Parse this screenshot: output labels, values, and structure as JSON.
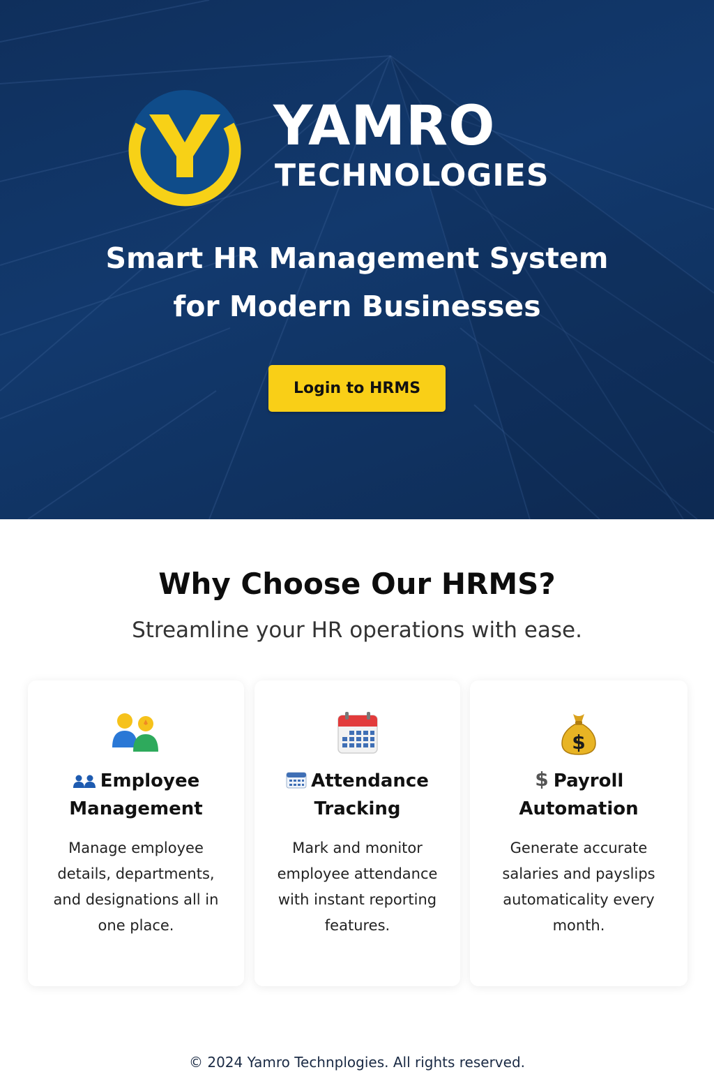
{
  "brand": {
    "name": "YAMRO",
    "subtitle": "TECHNOLOGIES",
    "logo_letter": "Y"
  },
  "hero": {
    "tagline_line1": "Smart HR Management System",
    "tagline_line2": "for Modern Businesses",
    "login_button": "Login to HRMS"
  },
  "features": {
    "title": "Why Choose Our HRMS?",
    "subtitle": "Streamline your HR operations with ease.",
    "cards": [
      {
        "icon": "people-icon",
        "title_line1": "Employee",
        "title_line2": "Management",
        "description": "Manage employee details, departments, and designations all in one place."
      },
      {
        "icon": "calendar-icon",
        "title_line1": "Attendance",
        "title_line2": "Tracking",
        "description": "Mark and monitor employee attendance with instant reporting features."
      },
      {
        "icon": "money-bag-icon",
        "title_line1": "Payroll",
        "title_line2": "Automation",
        "description": "Generate accurate salaries and payslips automaticality every month."
      }
    ]
  },
  "footer": {
    "copyright": "© 2024 Yamro Technplogies. All rights reserved."
  },
  "colors": {
    "hero_bg": "#12396d",
    "accent_yellow": "#f9cf17",
    "logo_blue": "#0f4c8a"
  }
}
